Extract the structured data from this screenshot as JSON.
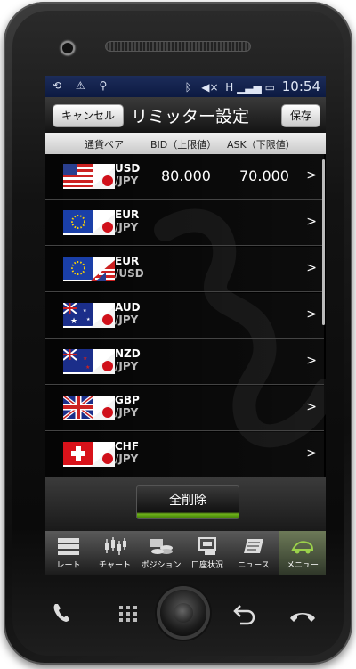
{
  "statusbar": {
    "left_icons": [
      "sync-icon",
      "warning-icon",
      "usb-icon"
    ],
    "right_icons": [
      "bluetooth-icon",
      "mute-icon",
      "signal-h-icon",
      "signal-bars-icon",
      "battery-icon"
    ],
    "time": "10:54"
  },
  "header": {
    "cancel_label": "キャンセル",
    "title": "リミッター設定",
    "save_label": "保存"
  },
  "columns": {
    "pair": "通貨ペア",
    "bid": "BID（上限値）",
    "ask": "ASK（下限値）"
  },
  "rows": [
    {
      "base": "USD",
      "quote": "/JPY",
      "bid": "80.000",
      "ask": "70.000",
      "chevron": ">"
    },
    {
      "base": "EUR",
      "quote": "/JPY",
      "bid": "",
      "ask": "",
      "chevron": ">"
    },
    {
      "base": "EUR",
      "quote": "/USD",
      "bid": "",
      "ask": "",
      "chevron": ">"
    },
    {
      "base": "AUD",
      "quote": "/JPY",
      "bid": "",
      "ask": "",
      "chevron": ">"
    },
    {
      "base": "NZD",
      "quote": "/JPY",
      "bid": "",
      "ask": "",
      "chevron": ">"
    },
    {
      "base": "GBP",
      "quote": "/JPY",
      "bid": "",
      "ask": "",
      "chevron": ">"
    },
    {
      "base": "CHF",
      "quote": "/JPY",
      "bid": "",
      "ask": "",
      "chevron": ">"
    }
  ],
  "delete_all_label": "全削除",
  "tabs": [
    {
      "label": "レート",
      "icon": "list-icon"
    },
    {
      "label": "チャート",
      "icon": "chart-icon"
    },
    {
      "label": "ポジション",
      "icon": "coins-icon"
    },
    {
      "label": "口座状況",
      "icon": "account-icon"
    },
    {
      "label": "ニュース",
      "icon": "news-icon"
    },
    {
      "label": "メニュー",
      "icon": "menu-icon",
      "active": true
    }
  ],
  "colors": {
    "accent_green": "#6fb31a",
    "status_bar": "#0c1a42"
  }
}
